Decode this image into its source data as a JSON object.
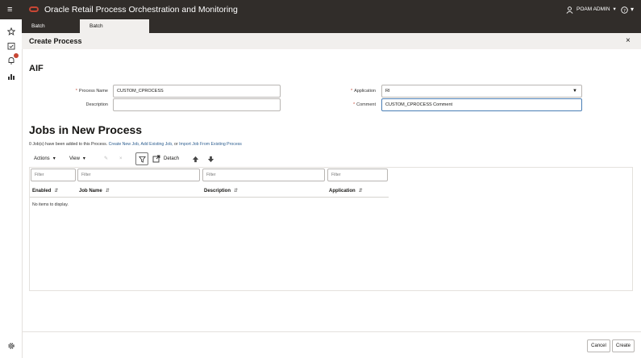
{
  "app": {
    "title": "Oracle Retail Process Orchestration and Monitoring",
    "user": "POAM ADMIN",
    "help_icon": "help-icon"
  },
  "tabs": [
    {
      "label": "Batch Monitoring"
    },
    {
      "label": "Batch Administration",
      "close": "×"
    }
  ],
  "page": {
    "title": "Create Process",
    "close": "×"
  },
  "section": {
    "title": "AIF"
  },
  "form": {
    "process_name": {
      "label": "Process Name",
      "value": "CUSTOM_CPROCESS"
    },
    "description": {
      "label": "Description",
      "value": ""
    },
    "application": {
      "label": "Application",
      "value": "RI"
    },
    "comment": {
      "label": "Comment",
      "value": "CUSTOM_CPROCESS Comment"
    }
  },
  "jobs": {
    "title": "Jobs in New Process",
    "info_prefix": "0 Job(s) have been added to this Process.",
    "link_create": "Create New Job,",
    "link_add": "Add Existing Job,",
    "info_or": "or",
    "link_import": "Import Job From Existing Process",
    "toolbar": {
      "actions": "Actions",
      "view": "View",
      "detach": "Detach"
    },
    "filter_placeholder": "Filter",
    "columns": [
      "Enabled",
      "Job Name",
      "Description",
      "Application"
    ],
    "empty": "No items to display."
  },
  "buttons": {
    "cancel": "Cancel",
    "create": "Create"
  },
  "colors": {
    "header_bg": "#312d2a",
    "accent": "#c74634",
    "link": "#2c5d8f"
  }
}
